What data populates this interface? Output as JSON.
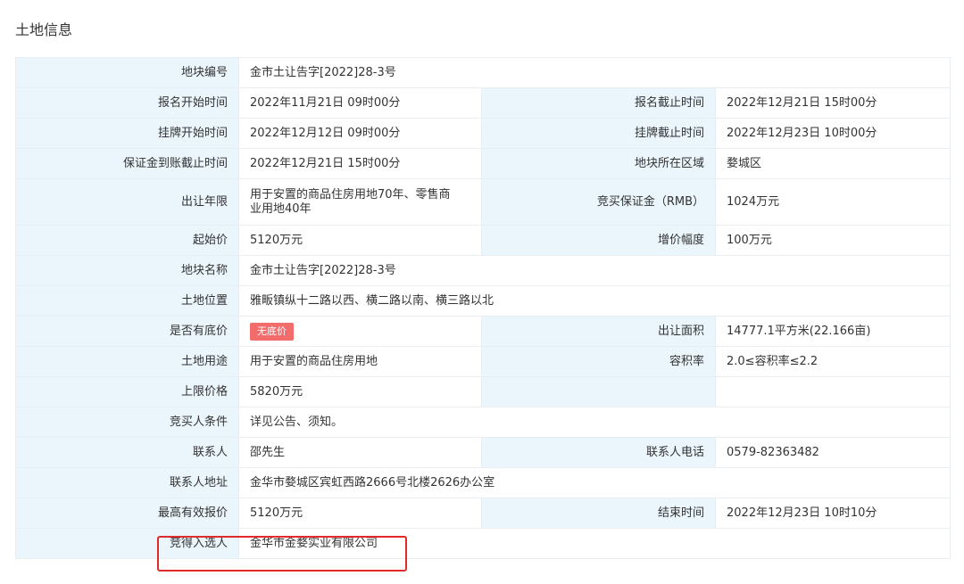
{
  "page_title": "土地信息",
  "rows": [
    {
      "type": "full",
      "label": "地块编号",
      "value": "金市土让告字[2022]28-3号"
    },
    {
      "type": "pair",
      "label1": "报名开始时间",
      "value1": "2022年11月21日 09时00分",
      "label2": "报名截止时间",
      "value2": "2022年12月21日 15时00分"
    },
    {
      "type": "pair",
      "label1": "挂牌开始时间",
      "value1": "2022年12月12日 09时00分",
      "label2": "挂牌截止时间",
      "value2": "2022年12月23日 10时00分"
    },
    {
      "type": "pair",
      "label1": "保证金到账截止时间",
      "value1": "2022年12月21日 15时00分",
      "label2": "地块所在区域",
      "value2": "婺城区"
    },
    {
      "type": "pair",
      "tall": true,
      "label1": "出让年限",
      "value1": "用于安置的商品住房用地70年、零售商业用地40年",
      "label2": "竞买保证金（RMB）",
      "value2": "1024万元"
    },
    {
      "type": "pair",
      "label1": "起始价",
      "value1": "5120万元",
      "label2": "增价幅度",
      "value2": "100万元"
    },
    {
      "type": "full",
      "label": "地块名称",
      "value": "金市土让告字[2022]28-3号"
    },
    {
      "type": "full",
      "label": "土地位置",
      "value": "雅畈镇纵十二路以西、横二路以南、横三路以北"
    },
    {
      "type": "pair",
      "badge": true,
      "label1": "是否有底价",
      "value1": "无底价",
      "label2": "出让面积",
      "value2": "14777.1平方米(22.166亩)"
    },
    {
      "type": "pair",
      "label1": "土地用途",
      "value1": "用于安置的商品住房用地",
      "label2": "容积率",
      "value2": "2.0≤容积率≤2.2"
    },
    {
      "type": "pair",
      "label1": "上限价格",
      "value1": "5820万元",
      "label2": "",
      "value2": ""
    },
    {
      "type": "full",
      "label": "竞买人条件",
      "value": "详见公告、须知。"
    },
    {
      "type": "pair",
      "label1": "联系人",
      "value1": "邵先生",
      "label2": "联系人电话",
      "value2": "0579-82363482"
    },
    {
      "type": "full",
      "label": "联系人地址",
      "value": "金华市婺城区宾虹西路2666号北楼2626办公室"
    },
    {
      "type": "pair",
      "label1": "最高有效报价",
      "value1": "5120万元",
      "label2": "结束时间",
      "value2": "2022年12月23日 10时10分"
    },
    {
      "type": "full",
      "label": "竞得入选人",
      "value": "金华市金婺实业有限公司"
    }
  ]
}
